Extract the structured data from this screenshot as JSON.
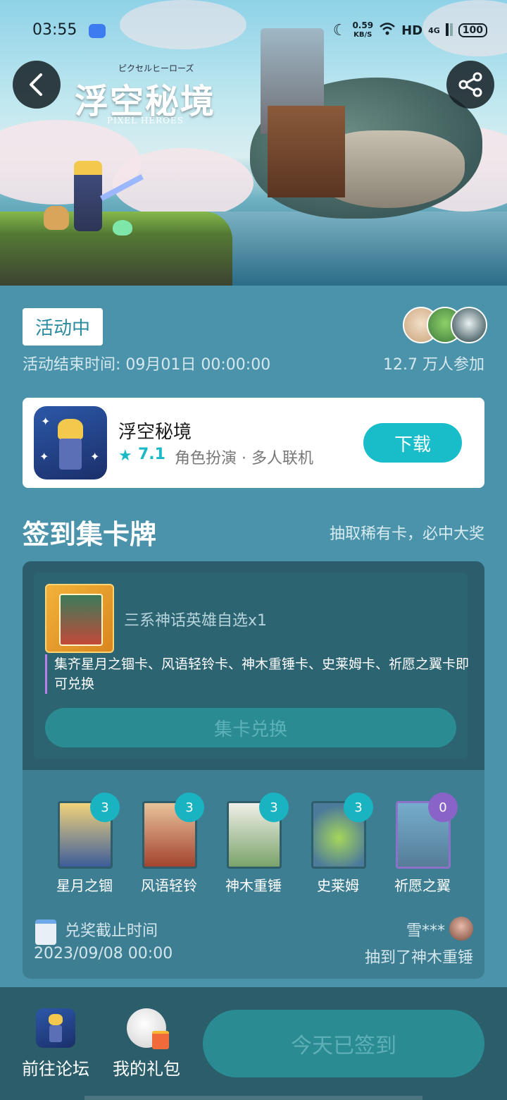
{
  "status_bar": {
    "time": "03:55",
    "net_speed_value": "0.59",
    "net_speed_unit": "KB/S",
    "network": "HD",
    "signal_type": "4G",
    "battery": "100"
  },
  "hero": {
    "game_logo_title": "浮空秘境",
    "game_logo_ruby": "ピクセルヒーローズ",
    "game_logo_subtitle": "PIXEL HEROES"
  },
  "event": {
    "status_badge": "活动中",
    "end_time": "活动结束时间: 09月01日 00:00:00",
    "participants": "12.7 万人参加"
  },
  "app_card": {
    "name": "浮空秘境",
    "rating": "7.1",
    "tags": "角色扮演 · 多人联机",
    "download_label": "下载"
  },
  "section": {
    "title": "签到集卡牌",
    "subtitle": "抽取稀有卡，必中大奖"
  },
  "reward": {
    "title": "三系神话英雄自选x1",
    "description": "集齐星月之锢卡、风语轻铃卡、神木重锤卡、史莱姆卡、祈愿之翼卡即可兑换",
    "redeem_label": "集卡兑换"
  },
  "cards": [
    {
      "name": "星月之锢",
      "count": "3"
    },
    {
      "name": "风语轻铃",
      "count": "3"
    },
    {
      "name": "神木重锤",
      "count": "3"
    },
    {
      "name": "史莱姆",
      "count": "3"
    },
    {
      "name": "祈愿之翼",
      "count": "0"
    }
  ],
  "deadline": {
    "label": "兑奖截止时间",
    "date": "2023/09/08 00:00"
  },
  "winner": {
    "name": "雪***",
    "text": "抽到了神木重锤"
  },
  "bottom_bar": {
    "forum_label": "前往论坛",
    "gift_label": "我的礼包",
    "checkin_label": "今天已签到"
  },
  "colors": {
    "accent": "#19bdc9",
    "background": "#4b93aa",
    "panel": "#2b5d6c",
    "badge_text": "#2a8aa0",
    "zero_badge": "#8a63c9"
  }
}
